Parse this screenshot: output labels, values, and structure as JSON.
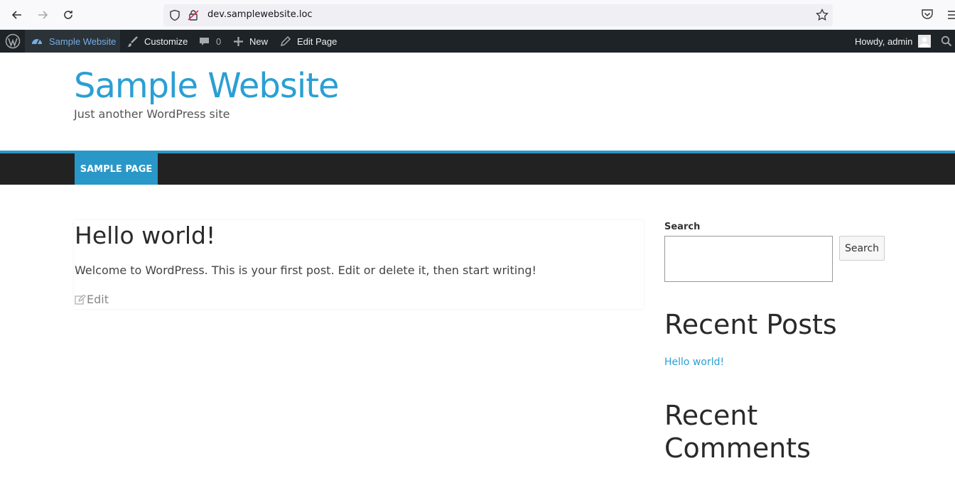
{
  "browser": {
    "url": "dev.samplewebsite.loc",
    "icons": [
      "back-icon",
      "forward-icon",
      "reload-icon",
      "shield-icon",
      "lock-icon",
      "bookmark-star-icon",
      "pocket-icon",
      "menu-icon"
    ]
  },
  "admin_bar": {
    "site_name": "Sample Website",
    "customize": "Customize",
    "comments_count": "0",
    "new": "New",
    "edit_page": "Edit Page",
    "greeting": "Howdy, admin"
  },
  "site": {
    "title": "Sample Website",
    "tagline": "Just another WordPress site"
  },
  "nav": {
    "items": [
      "SAMPLE PAGE"
    ]
  },
  "post": {
    "title": "Hello world!",
    "body": "Welcome to WordPress. This is your first post. Edit or delete it, then start writing!",
    "edit_label": "Edit"
  },
  "sidebar": {
    "search_label": "Search",
    "search_button": "Search",
    "recent_posts_title": "Recent Posts",
    "recent_posts": [
      "Hello world!"
    ],
    "recent_comments_title_line1": "Recent",
    "recent_comments_title_line2": "Comments"
  },
  "colors": {
    "accent": "#2b9fd3",
    "admin_bar_bg": "#1d2327",
    "nav_bg": "#222222"
  }
}
